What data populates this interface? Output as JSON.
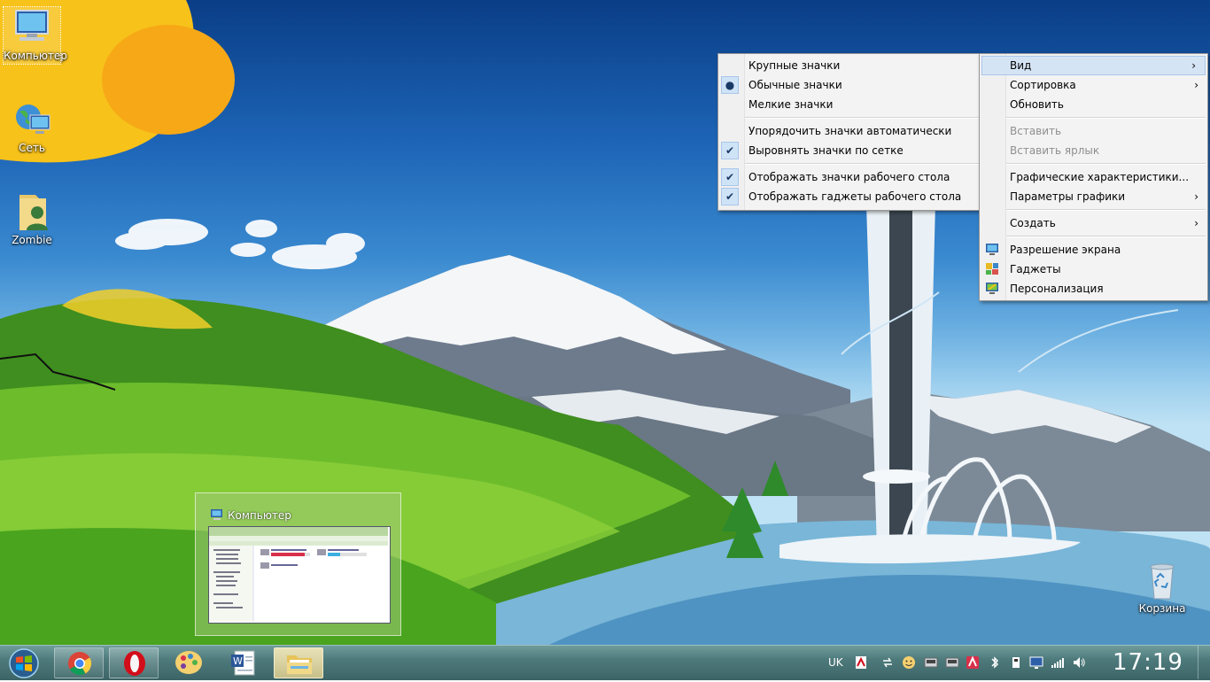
{
  "desktop_icons": [
    {
      "label": "Компьютер",
      "selected": true
    },
    {
      "label": "Сеть"
    },
    {
      "label": "Zombie"
    },
    {
      "label": "Корзина"
    }
  ],
  "view_submenu": {
    "items": [
      {
        "label": "Крупные значки",
        "mark": ""
      },
      {
        "label": "Обычные значки",
        "mark": "●"
      },
      {
        "label": "Мелкие значки",
        "mark": ""
      },
      {
        "label": "Упорядочить значки автоматически",
        "mark": ""
      },
      {
        "label": "Выровнять значки по сетке",
        "mark": "✔"
      },
      {
        "label": "Отображать значки рабочего стола",
        "mark": "✔"
      },
      {
        "label": "Отображать гаджеты  рабочего стола",
        "mark": "✔"
      }
    ]
  },
  "context_menu": {
    "items": [
      {
        "label": "Вид",
        "arrow": "›"
      },
      {
        "label": "Сортировка",
        "arrow": "›"
      },
      {
        "label": "Обновить"
      },
      {
        "label": "Вставить",
        "disabled": true
      },
      {
        "label": "Вставить ярлык",
        "disabled": true
      },
      {
        "label": "Графические характеристики..."
      },
      {
        "label": "Параметры графики",
        "arrow": "›"
      },
      {
        "label": "Создать",
        "arrow": "›"
      },
      {
        "label": "Разрешение экрана",
        "icon": "display-icon"
      },
      {
        "label": "Гаджеты",
        "icon": "gadgets-icon"
      },
      {
        "label": "Персонализация",
        "icon": "personalize-icon"
      }
    ]
  },
  "preview": {
    "title": "Компьютер"
  },
  "taskbar": {
    "apps": [
      "start-orb",
      "chrome-icon",
      "opera-icon",
      "paint-icon",
      "word-icon",
      "explorer-icon"
    ],
    "language": "UK",
    "clock": "17:19"
  },
  "colors": {
    "menu_bg": "#f3f3f3",
    "highlight": "#d5e4f5",
    "taskbar": "#4e7a7c"
  }
}
